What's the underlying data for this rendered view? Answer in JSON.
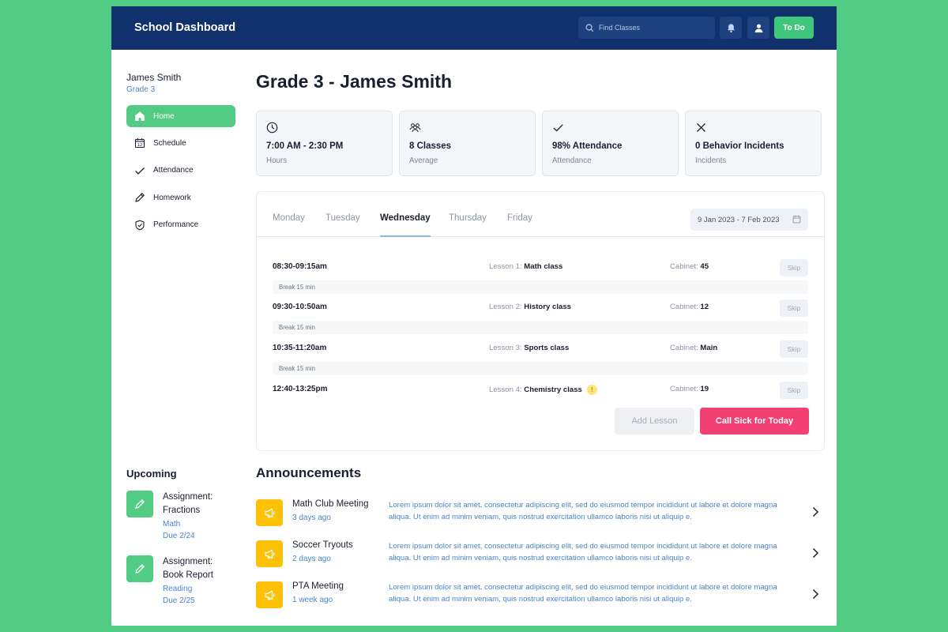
{
  "header": {
    "brand": "School Dashboard",
    "search_placeholder": "Find Classes",
    "todo_label": "To Do"
  },
  "user": {
    "name": "James Smith",
    "grade": "Grade 3"
  },
  "nav": [
    {
      "label": "Home",
      "icon": "home-icon",
      "active": true
    },
    {
      "label": "Schedule",
      "icon": "calendar-icon",
      "active": false
    },
    {
      "label": "Attendance",
      "icon": "check-icon",
      "active": false
    },
    {
      "label": "Homework",
      "icon": "pencil-icon",
      "active": false
    },
    {
      "label": "Performance",
      "icon": "shield-check-icon",
      "active": false
    }
  ],
  "upcoming": {
    "title": "Upcoming",
    "items": [
      {
        "title": "Assignment: Fractions",
        "subject": "Math",
        "due": "Due 2/24"
      },
      {
        "title": "Assignment: Book Report",
        "subject": "Reading",
        "due": "Due 2/25"
      }
    ]
  },
  "page_title": "Grade 3 - James Smith",
  "stats": [
    {
      "value": "7:00 AM - 2:30 PM",
      "label": "Hours",
      "icon": "clock-icon"
    },
    {
      "value": "8 Classes",
      "label": "Average",
      "icon": "users-icon"
    },
    {
      "value": "98% Attendance",
      "label": "Attendance",
      "icon": "check-icon"
    },
    {
      "value": "0 Behavior Incidents",
      "label": "Incidents",
      "icon": "x-icon"
    }
  ],
  "schedule": {
    "days": [
      "Monday",
      "Tuesday",
      "Wednesday",
      "Thursday",
      "Friday"
    ],
    "active_day": "Wednesday",
    "date_range": "9 Jan 2023 - 7 Feb 2023",
    "lesson_prefix_1": "Lesson 1:",
    "lesson_prefix_2": "Lesson 2:",
    "lesson_prefix_3": "Lesson 3:",
    "lesson_prefix_4": "Lesson 4:",
    "cabinet_prefix": "Cabinet:",
    "lessons": [
      {
        "time": "08:30-09:15am",
        "name": "Math class",
        "cabinet": "45",
        "skip": "Skip"
      },
      {
        "time": "09:30-10:50am",
        "name": "History class",
        "cabinet": "12",
        "skip": "Skip"
      },
      {
        "time": "10:35-11:20am",
        "name": "Sports class",
        "cabinet": "Main",
        "skip": "Skip"
      },
      {
        "time": "12:40-13:25pm",
        "name": "Chemistry class",
        "cabinet": "19",
        "skip": "Skip",
        "warning": "!"
      }
    ],
    "break_label": "Break 15 min",
    "add_lesson": "Add Lesson",
    "call_sick": "Call Sick for Today"
  },
  "announcements": {
    "title": "Announcements",
    "items": [
      {
        "name": "Math Club Meeting",
        "time": "3 days ago",
        "text": "Lorem ipsum dolor sit amet, consectetur adipiscing elit, sed do eiusmod  tempor incididunt ut labore et dolore magna aliqua. Ut enim ad minim  veniam, quis nostrud exercitation ullamco laboris nisi ut aliquip e."
      },
      {
        "name": "Soccer Tryouts",
        "time": "2 days ago",
        "text": "Lorem ipsum dolor sit amet, consectetur adipiscing elit, sed do eiusmod  tempor incididunt ut labore et dolore magna aliqua. Ut enim ad minim  veniam, quis nostrud exercitation ullamco laboris nisi ut aliquip e."
      },
      {
        "name": "PTA Meeting",
        "time": "1 week ago",
        "text": "Lorem ipsum dolor sit amet, consectetur adipiscing elit, sed do eiusmod  tempor incididunt ut labore et dolore magna aliqua. Ut enim ad minim  veniam, quis nostrud exercitation ullamco laboris nisi ut aliquip e."
      }
    ]
  },
  "colors": {
    "background": "#52cc85",
    "topbar": "#10316b",
    "accent_green": "#52cc85",
    "accent_pink": "#f23f74",
    "accent_yellow": "#ffc107",
    "link_blue": "#4b84c9"
  }
}
